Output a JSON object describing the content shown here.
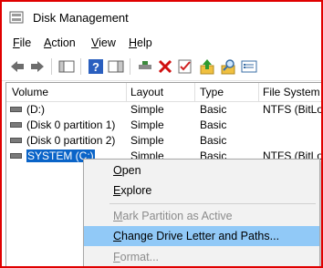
{
  "window": {
    "title": "Disk Management",
    "border_color": "#e00000"
  },
  "menubar": {
    "items": [
      {
        "label": "File",
        "accel": "F",
        "rest": "ile"
      },
      {
        "label": "Action",
        "accel": "A",
        "rest": "ction"
      },
      {
        "label": "View",
        "accel": "V",
        "rest": "iew"
      },
      {
        "label": "Help",
        "accel": "H",
        "rest": "elp"
      }
    ]
  },
  "toolbar": {
    "icons": [
      "back-arrow-icon",
      "forward-arrow-icon",
      "console-tree-icon",
      "help-icon",
      "action-pane-icon",
      "connect-icon",
      "delete-icon",
      "properties-icon",
      "up-icon",
      "search-icon",
      "settings-icon"
    ]
  },
  "table": {
    "columns": [
      "Volume",
      "Layout",
      "Type",
      "File System"
    ],
    "rows": [
      {
        "volume": "(D:)",
        "layout": "Simple",
        "type": "Basic",
        "fs": "NTFS (BitLo..."
      },
      {
        "volume": "(Disk 0 partition 1)",
        "layout": "Simple",
        "type": "Basic",
        "fs": ""
      },
      {
        "volume": "(Disk 0 partition 2)",
        "layout": "Simple",
        "type": "Basic",
        "fs": ""
      },
      {
        "volume": "SYSTEM (C:)",
        "layout": "Simple",
        "type": "Basic",
        "fs": "NTFS (BitLo..."
      }
    ],
    "selected_row": 3,
    "selection_color": "#0a64c8"
  },
  "context_menu": {
    "items": [
      {
        "label": "Open",
        "accel": "O",
        "rest": "pen",
        "disabled": false
      },
      {
        "label": "Explore",
        "accel": "E",
        "rest": "xplore",
        "disabled": false
      },
      {
        "label": "Mark Partition as Active",
        "accel": "M",
        "rest": "ark Partition as Active",
        "disabled": true
      },
      {
        "label": "Change Drive Letter and Paths...",
        "accel": "C",
        "rest": "hange Drive Letter and Paths...",
        "disabled": false,
        "highlighted": true
      },
      {
        "label": "Format...",
        "accel": "F",
        "rest": "ormat...",
        "disabled": true
      }
    ],
    "highlight_color": "#91c9f7"
  }
}
